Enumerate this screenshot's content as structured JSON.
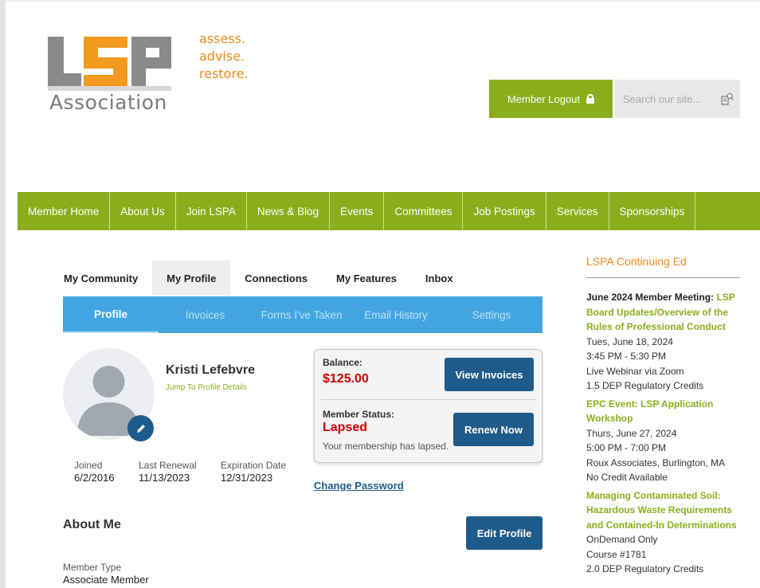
{
  "brand": {
    "logo_text": "LSP",
    "logo_sub": "Association",
    "tagline": [
      "assess.",
      "advise.",
      "restore."
    ]
  },
  "header": {
    "logout_label": "Member Logout",
    "search_placeholder": "Search our site..."
  },
  "main_nav": [
    "Member Home",
    "About Us",
    "Join LSPA",
    "News & Blog",
    "Events",
    "Committees",
    "Job Postings",
    "Services",
    "Sponsorships"
  ],
  "community_tabs": {
    "items": [
      "My Community",
      "My Profile",
      "Connections",
      "My Features",
      "Inbox"
    ],
    "active": "My Profile"
  },
  "profile_tabs": {
    "items": [
      "Profile",
      "Invoices",
      "Forms I've Taken",
      "Email History",
      "Settings"
    ],
    "active": "Profile"
  },
  "profile": {
    "name": "Kristi Lefebvre",
    "jump_link": "Jump To Profile Details",
    "joined_label": "Joined",
    "joined": "6/2/2016",
    "last_renewal_label": "Last Renewal",
    "last_renewal": "11/13/2023",
    "expiration_label": "Expiration Date",
    "expiration": "12/31/2023"
  },
  "balance_card": {
    "balance_label": "Balance:",
    "balance": "$125.00",
    "view_invoices": "View Invoices",
    "status_label": "Member Status:",
    "status": "Lapsed",
    "status_message": "Your membership has lapsed.",
    "renew": "Renew Now"
  },
  "change_password": "Change Password",
  "about": {
    "heading": "About Me",
    "edit_profile": "Edit Profile",
    "member_type_label": "Member Type",
    "member_type": "Associate Member"
  },
  "sidebar": {
    "title": "LSPA Continuing Ed",
    "events": [
      {
        "title_plain": "June 2024 Member Meeting: ",
        "title_link": "LSP Board Updates/Overview of the Rules of Professional Conduct",
        "lines": [
          "Tues, June 18, 2024",
          "3:45 PM - 5:30 PM",
          "Live Webinar via Zoom",
          "1.5 DEP Regulatory Credits"
        ]
      },
      {
        "title_plain": "",
        "title_link": "EPC Event: LSP Application Workshop",
        "lines": [
          "Thurs, June 27, 2024",
          "5:00 PM - 7:00 PM",
          "Roux Associates, Burlington, MA",
          "No Credit Available"
        ]
      },
      {
        "title_plain": "",
        "title_link": "Managing Contaminated Soil: Hazardous Waste Requirements and Contained-In Determinations",
        "lines": [
          "OnDemand Only",
          "Course #1781",
          "2.0 DEP Regulatory Credits"
        ]
      }
    ]
  },
  "colors": {
    "brand_green": "#8aae1b",
    "tab_blue": "#42a5e1",
    "button_navy": "#1e5b8a",
    "accent_orange": "#ee8a20",
    "alert_red": "#cc0000"
  }
}
